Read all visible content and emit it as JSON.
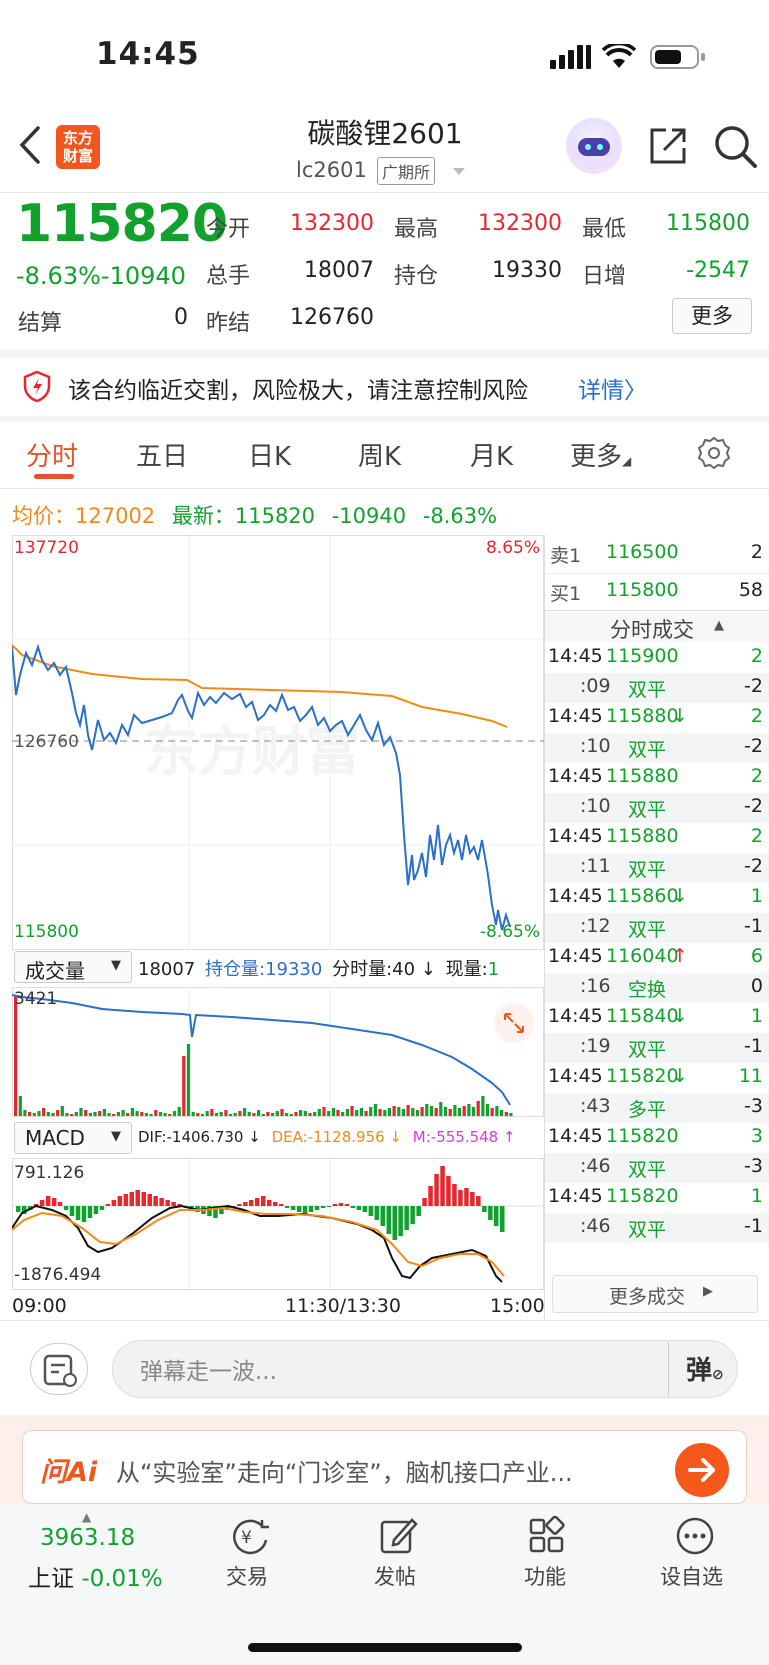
{
  "status_bar": {
    "time": "14:45"
  },
  "header": {
    "logo_text": "东方财富",
    "title": "碳酸锂2601",
    "code": "lc2601",
    "exchange": "广期所"
  },
  "quote": {
    "price": "115820",
    "change": "-8.63%-10940",
    "fields": [
      {
        "label": "今开",
        "value": "132300",
        "color": "red"
      },
      {
        "label": "最高",
        "value": "132300",
        "color": "red"
      },
      {
        "label": "最低",
        "value": "115800",
        "color": "green"
      },
      {
        "label": "总手",
        "value": "18007",
        "color": "black"
      },
      {
        "label": "持仓",
        "value": "19330",
        "color": "black"
      },
      {
        "label": "日增",
        "value": "-2547",
        "color": "green"
      },
      {
        "label": "结算",
        "value": "0",
        "color": "black"
      },
      {
        "label": "昨结",
        "value": "126760",
        "color": "black"
      }
    ],
    "more_label": "更多"
  },
  "warning": {
    "text": "该合约临近交割，风险极大，请注意控制风险",
    "link": "详情"
  },
  "tabs": [
    "分时",
    "五日",
    "日K",
    "周K",
    "月K",
    "更多"
  ],
  "info_line": {
    "avg_label": "均价：",
    "avg_value": "127002",
    "latest_label": "最新：",
    "latest_value": "115820",
    "change": "-10940",
    "change_pct": "-8.63%"
  },
  "price_chart": {
    "y_max": "137720",
    "y_mid": "126760",
    "y_min": "115800",
    "pct_max": "8.65%",
    "pct_min": "-8.65%",
    "watermark": "东方财富"
  },
  "volume_panel": {
    "selector": "成交量",
    "total": "18007",
    "oi_label": "持仓量:",
    "oi_value": "19330",
    "vol_label": "分时量:",
    "vol_value": "40 ↓",
    "cur_label": "现量:",
    "cur_value": "1",
    "axis_max": "3421"
  },
  "macd_panel": {
    "selector": "MACD",
    "dif": "DIF:-1406.730 ↓",
    "dea": "DEA:-1128.956 ↓",
    "m": "M:-555.548 ↑",
    "axis_max": "791.126",
    "axis_min": "-1876.494"
  },
  "time_axis": {
    "start": "09:00",
    "mid": "11:30/13:30",
    "end": "15:00"
  },
  "order_book": {
    "ask_label": "卖1",
    "ask_price": "116500",
    "ask_vol": "2",
    "bid_label": "买1",
    "bid_price": "115800",
    "bid_vol": "58"
  },
  "ticks_header": "分时成交",
  "ticks": [
    {
      "time": "14:45",
      "price": "115900",
      "arrow": "",
      "vol": "2",
      "sub_time": ":09",
      "type": "双平",
      "oi": "-2"
    },
    {
      "time": "14:45",
      "price": "115880",
      "arrow": "↓",
      "vol": "2",
      "sub_time": ":10",
      "type": "双平",
      "oi": "-2"
    },
    {
      "time": "14:45",
      "price": "115880",
      "arrow": "",
      "vol": "2",
      "sub_time": ":10",
      "type": "双平",
      "oi": "-2"
    },
    {
      "time": "14:45",
      "price": "115880",
      "arrow": "",
      "vol": "2",
      "sub_time": ":11",
      "type": "双平",
      "oi": "-2"
    },
    {
      "time": "14:45",
      "price": "115860",
      "arrow": "↓",
      "vol": "1",
      "sub_time": ":12",
      "type": "双平",
      "oi": "-1"
    },
    {
      "time": "14:45",
      "price": "116040",
      "arrow": "↑",
      "vol": "6",
      "sub_time": ":16",
      "type": "空换",
      "oi": "0"
    },
    {
      "time": "14:45",
      "price": "115840",
      "arrow": "↓",
      "vol": "1",
      "sub_time": ":19",
      "type": "双平",
      "oi": "-1"
    },
    {
      "time": "14:45",
      "price": "115820",
      "arrow": "↓",
      "vol": "11",
      "sub_time": ":43",
      "type": "多平",
      "oi": "-3"
    },
    {
      "time": "14:45",
      "price": "115820",
      "arrow": "",
      "vol": "3",
      "sub_time": ":46",
      "type": "双平",
      "oi": "-3"
    },
    {
      "time": "14:45",
      "price": "115820",
      "arrow": "",
      "vol": "1",
      "sub_time": ":46",
      "type": "双平",
      "oi": "-1"
    }
  ],
  "ticks_more": "更多成交",
  "danmu": {
    "placeholder": "弹幕走一波...",
    "button": "弹"
  },
  "ai_banner": {
    "logo": "问Ai",
    "text": "从“实验室”走向“门诊室”，脑机接口产业..."
  },
  "tabbar": {
    "index_value": "3963.18",
    "index_label": "上证",
    "index_change": "-0.01%",
    "items": [
      "交易",
      "发帖",
      "功能",
      "设自选"
    ]
  },
  "colors": {
    "up": "#e8262e",
    "down": "#12a12c",
    "avg": "#f28a16",
    "price_line": "#2a6fc9",
    "accent": "#e8522a"
  }
}
